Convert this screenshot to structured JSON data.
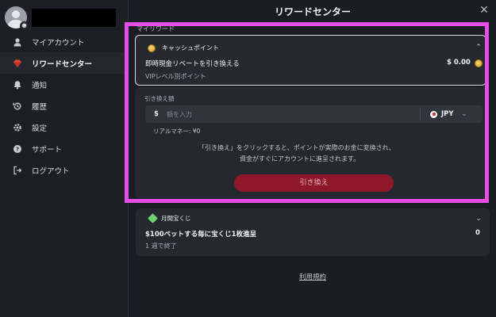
{
  "page": {
    "title": "リワードセンター",
    "close_icon": "close-icon"
  },
  "sidebar": {
    "items": [
      {
        "label": "マイアカウント",
        "icon": "user-icon",
        "active": false
      },
      {
        "label": "リワードセンター",
        "icon": "gem-icon",
        "active": true
      },
      {
        "label": "通知",
        "icon": "bell-icon",
        "active": false
      },
      {
        "label": "履歴",
        "icon": "history-icon",
        "active": false
      },
      {
        "label": "設定",
        "icon": "gear-icon",
        "active": false
      },
      {
        "label": "サポート",
        "icon": "help-icon",
        "active": false
      },
      {
        "label": "ログアウト",
        "icon": "logout-icon",
        "active": false
      }
    ]
  },
  "my_rewards": {
    "section_label": "マイリワード",
    "cash_points": {
      "title": "キャッシュポイント",
      "instant_rebate_label": "即時現金リベートを引き換える",
      "amount": "$ 0.00",
      "vip_label": "VIPレベル別ポイント"
    }
  },
  "exchange": {
    "amount_label": "引き換え額",
    "currency_symbol": "$",
    "placeholder": "額を入力",
    "currency": "JPY",
    "real_money_label": "リアルマネー: ¥0",
    "info_line1": "「引き換え」をクリックすると、ポイントが実際のお金に変換され、",
    "info_line2": "資金がすぐにアカウントに進呈されます。",
    "button_label": "引き換え"
  },
  "lottery": {
    "title": "月間宝くじ",
    "description": "$100ベットする毎に宝くじ1枚進呈",
    "count": "0",
    "ends": "1 週で終了"
  },
  "footer": {
    "terms_link": "利用規約"
  },
  "colors": {
    "accent_red": "#8e1728",
    "highlight": "#e64ce6",
    "lottery_green": "#6fd16a"
  }
}
